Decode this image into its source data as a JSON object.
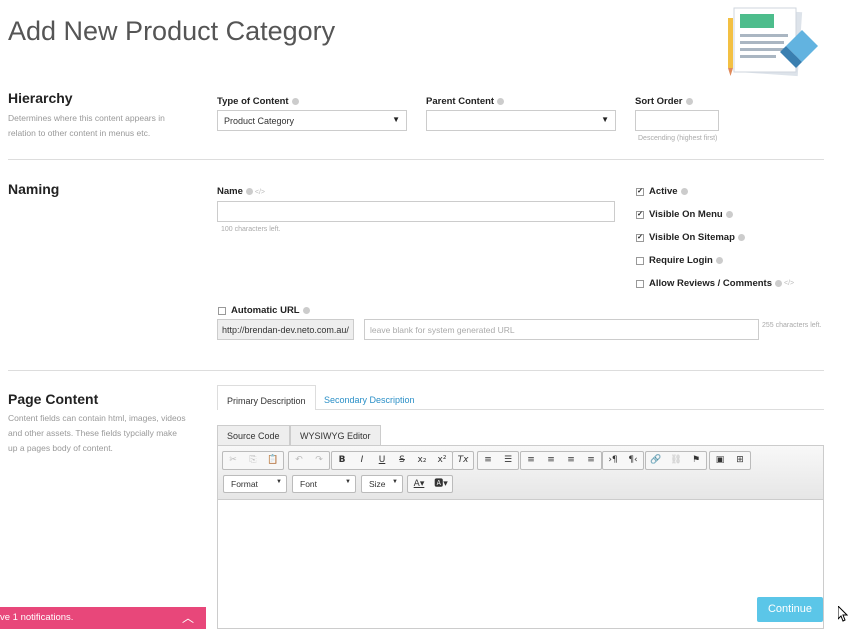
{
  "page": {
    "title": "Add New Product Category"
  },
  "hierarchy": {
    "title": "Hierarchy",
    "description": "Determines where this content appears in relation to other content in menus etc.",
    "type_label": "Type of Content",
    "type_value": "Product Category",
    "parent_label": "Parent Content",
    "parent_value": "",
    "sort_label": "Sort Order",
    "sort_hint": "Descending (highest first)"
  },
  "naming": {
    "title": "Naming",
    "name_label": "Name",
    "name_hint": "100 characters left.",
    "options": [
      {
        "label": "Active",
        "checked": true
      },
      {
        "label": "Visible On Menu",
        "checked": true
      },
      {
        "label": "Visible On Sitemap",
        "checked": true
      },
      {
        "label": "Require Login",
        "checked": false
      },
      {
        "label": "Allow Reviews / Comments",
        "checked": false
      }
    ],
    "auto_url_label": "Automatic URL",
    "url_prefix": "http://brendan-dev.neto.com.au/",
    "url_placeholder": "leave blank for system generated URL",
    "url_hint": "255 characters left."
  },
  "page_content": {
    "title": "Page Content",
    "description": "Content fields can contain html, images, videos and other assets. These fields typcially make up a pages body of content.",
    "tabs": [
      "Primary Description",
      "Secondary Description"
    ],
    "editor_tabs": [
      "Source Code",
      "WYSIWYG Editor"
    ],
    "combos": [
      "Format",
      "Font",
      "Size"
    ]
  },
  "notifications": {
    "text": "ve 1 notifications."
  },
  "actions": {
    "continue_label": "Continue"
  },
  "colors": {
    "accent": "#2a8fc7",
    "continue": "#5bc6e8",
    "notify": "#e8477a"
  }
}
